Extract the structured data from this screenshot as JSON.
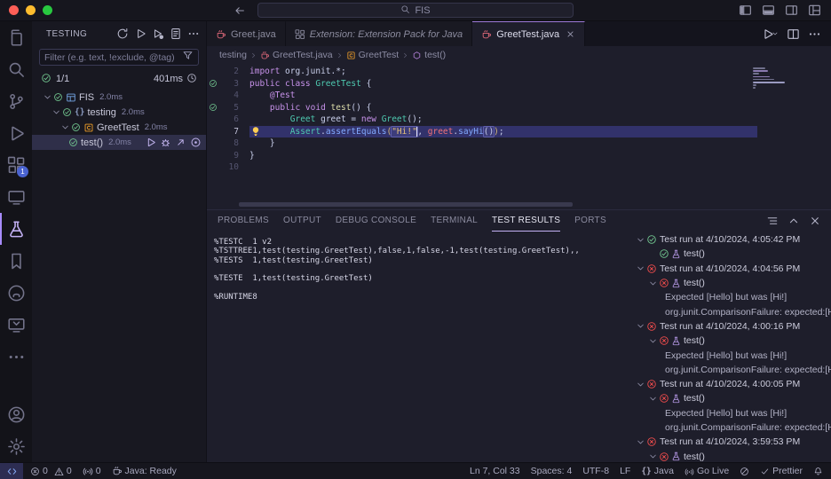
{
  "colors": {
    "accent_purple": "#a78bfa",
    "pass_green": "#73c991",
    "fail_red": "#f14c4c",
    "badge_blue": "#4a63d0",
    "java_red": "#e0697a",
    "class_orange": "#ee9d28",
    "method_purple": "#b180d7",
    "keyword_purple": "#c792ea",
    "type_teal": "#4ec9b0",
    "call_blue": "#82aaff",
    "string_amber": "#e5c07b"
  },
  "titlebar": {
    "search_value": "FIS",
    "window_controls": [
      "toggle-primary-sidebar",
      "toggle-panel",
      "toggle-secondary-sidebar",
      "customize-layout"
    ]
  },
  "activity_bar": {
    "extensions_badge": "1",
    "items": [
      {
        "name": "explorer",
        "icon": "files"
      },
      {
        "name": "search",
        "icon": "search"
      },
      {
        "name": "source-control",
        "icon": "scm"
      },
      {
        "name": "run-and-debug",
        "icon": "debug"
      },
      {
        "name": "extensions",
        "icon": "ext",
        "badge": "1"
      },
      {
        "name": "remote-window",
        "icon": "monitor"
      },
      {
        "name": "testing",
        "icon": "beaker",
        "active": true
      },
      {
        "name": "bookmarks",
        "icon": "bookmark"
      },
      {
        "name": "github",
        "icon": "github"
      },
      {
        "name": "remote-explorer",
        "icon": "monitor2"
      },
      {
        "name": "additional-views",
        "icon": "ellipsis"
      }
    ],
    "bottom_items": [
      {
        "name": "accounts",
        "icon": "account"
      },
      {
        "name": "manage",
        "icon": "gear"
      }
    ]
  },
  "sidebar": {
    "title": "TESTING",
    "actions": [
      {
        "name": "refresh-tests",
        "icon": "refresh"
      },
      {
        "name": "run-all-tests",
        "icon": "play"
      },
      {
        "name": "debug-all-tests",
        "icon": "playdot"
      },
      {
        "name": "show-test-output",
        "icon": "doc"
      },
      {
        "name": "more-view-actions",
        "icon": "ellipsis"
      }
    ],
    "filter_placeholder": "Filter (e.g. text, !exclude, @tag)",
    "summary": {
      "passed": "1/1",
      "duration": "401ms"
    },
    "tree": [
      {
        "label": "FIS",
        "duration": "2.0ms",
        "indent": 0,
        "icon": "grid",
        "icon_color": "#75a7e8",
        "twisty": true,
        "status": "pass"
      },
      {
        "label": "testing",
        "duration": "2.0ms",
        "indent": 1,
        "icon": "braces",
        "icon_color": "#8a9ac0",
        "twisty": true,
        "status": "pass"
      },
      {
        "label": "GreetTest",
        "duration": "2.0ms",
        "indent": 2,
        "icon": "classicon",
        "icon_color": "#ee9d28",
        "twisty": true,
        "status": "pass"
      },
      {
        "label": "test()",
        "duration": "2.0ms",
        "indent": 3,
        "twisty": false,
        "status": "pass",
        "selected": true,
        "actions": [
          {
            "name": "run-test",
            "icon": "play"
          },
          {
            "name": "debug-test",
            "icon": "bug"
          },
          {
            "name": "go-to-test",
            "icon": "goto"
          },
          {
            "name": "pick-test",
            "icon": "target"
          }
        ]
      }
    ]
  },
  "editor": {
    "tabs": [
      {
        "label": "Greet.java",
        "icon": "coffee",
        "icon_color": "#e0697a",
        "active": false,
        "italic": false,
        "close": false
      },
      {
        "label": "Extension: Extension Pack for Java",
        "icon": "ext",
        "icon_color": "#8a8a9e",
        "active": false,
        "italic": true,
        "close": false
      },
      {
        "label": "GreetTest.java",
        "icon": "coffee",
        "icon_color": "#e0697a",
        "active": true,
        "italic": false,
        "close": true
      }
    ],
    "actions": [
      {
        "name": "run-java",
        "icon": "play",
        "dropdown": true
      },
      {
        "name": "split-editor",
        "icon": "split"
      },
      {
        "name": "more-editor-actions",
        "icon": "ellipsis"
      }
    ],
    "breadcrumbs": [
      {
        "label": "testing"
      },
      {
        "label": "GreetTest.java",
        "icon": "coffee",
        "icon_color": "#e0697a"
      },
      {
        "label": "GreetTest",
        "icon": "classicon",
        "icon_color": "#ee9d28"
      },
      {
        "label": "test()",
        "icon": "method",
        "icon_color": "#b180d7"
      }
    ],
    "code": {
      "lines": [
        {
          "num": "2",
          "tokens": [
            {
              "c": "k",
              "t": "import"
            },
            {
              "c": "d",
              "t": " org.junit.*;"
            }
          ]
        },
        {
          "num": "3",
          "gutter": "pass",
          "tokens": [
            {
              "c": "k",
              "t": "public class "
            },
            {
              "c": "t",
              "t": "GreetTest"
            },
            {
              "c": "d",
              "t": " {"
            }
          ]
        },
        {
          "num": "4",
          "tokens": [
            {
              "c": "d",
              "t": "    "
            },
            {
              "c": "a",
              "t": "@Test"
            }
          ]
        },
        {
          "num": "5",
          "gutter": "pass",
          "tokens": [
            {
              "c": "d",
              "t": "    "
            },
            {
              "c": "k",
              "t": "public void "
            },
            {
              "c": "md",
              "t": "test"
            },
            {
              "c": "d",
              "t": "() {"
            }
          ]
        },
        {
          "num": "6",
          "tokens": [
            {
              "c": "d",
              "t": "        "
            },
            {
              "c": "t",
              "t": "Greet"
            },
            {
              "c": "d",
              "t": " greet = "
            },
            {
              "c": "k",
              "t": "new"
            },
            {
              "c": "d",
              "t": " "
            },
            {
              "c": "t",
              "t": "Greet"
            },
            {
              "c": "d",
              "t": "();"
            }
          ]
        },
        {
          "num": "7",
          "current": true,
          "lightbulb": true,
          "tokens": [
            {
              "c": "d",
              "t": "        "
            },
            {
              "c": "t",
              "t": "Assert"
            },
            {
              "c": "d",
              "t": "."
            },
            {
              "c": "mc",
              "t": "assertEquals"
            },
            {
              "c": "pb",
              "t": "("
            },
            {
              "c": "s",
              "t": "\"Hi!\"",
              "boxed": true,
              "cursor_after": true
            },
            {
              "c": "d",
              "t": ", "
            },
            {
              "c": "r",
              "t": "greet"
            },
            {
              "c": "d",
              "t": "."
            },
            {
              "c": "mc",
              "t": "sayHi"
            },
            {
              "c": "d",
              "t": "()",
              "boxed": true
            },
            {
              "c": "pb",
              "t": ")"
            },
            {
              "c": "d",
              "t": ";"
            }
          ]
        },
        {
          "num": "8",
          "tokens": [
            {
              "c": "d",
              "t": "    }"
            }
          ]
        },
        {
          "num": "9",
          "tokens": [
            {
              "c": "d",
              "t": "}"
            }
          ]
        },
        {
          "num": "10",
          "tokens": []
        }
      ]
    }
  },
  "panel": {
    "tabs": [
      {
        "label": "PROBLEMS"
      },
      {
        "label": "OUTPUT"
      },
      {
        "label": "DEBUG CONSOLE"
      },
      {
        "label": "TERMINAL"
      },
      {
        "label": "TEST RESULTS",
        "active": true
      },
      {
        "label": "PORTS"
      }
    ],
    "actions": [
      {
        "name": "view-options",
        "icon": "listtree"
      },
      {
        "name": "maximize-panel",
        "icon": "chevup"
      },
      {
        "name": "close-panel",
        "icon": "close"
      }
    ],
    "output_lines": [
      "%TESTC  1 v2",
      "%TSTTREE1,test(testing.GreetTest),false,1,false,-1,test(testing.GreetTest),,",
      "%TESTS  1,test(testing.GreetTest)",
      "",
      "%TESTE  1,test(testing.GreetTest)",
      "",
      "%RUNTIME8"
    ],
    "runs": [
      {
        "kind": "run",
        "status": "pass",
        "label": "Test run at 4/10/2024, 4:05:42 PM",
        "chevron": true
      },
      {
        "kind": "test",
        "status": "pass",
        "label": "test()",
        "chevron": false
      },
      {
        "kind": "run",
        "status": "fail",
        "label": "Test run at 4/10/2024, 4:04:56 PM",
        "chevron": true
      },
      {
        "kind": "test",
        "status": "fail",
        "label": "test()",
        "chevron": true
      },
      {
        "kind": "detail",
        "label": "Expected [Hello] but was [Hi!]"
      },
      {
        "kind": "detail",
        "label": "org.junit.ComparisonFailure: expected:[H[..."
      },
      {
        "kind": "run",
        "status": "fail",
        "label": "Test run at 4/10/2024, 4:00:16 PM",
        "chevron": true
      },
      {
        "kind": "test",
        "status": "fail",
        "label": "test()",
        "chevron": true
      },
      {
        "kind": "detail",
        "label": "Expected [Hello] but was [Hi!]"
      },
      {
        "kind": "detail",
        "label": "org.junit.ComparisonFailure: expected:[H[..."
      },
      {
        "kind": "run",
        "status": "fail",
        "label": "Test run at 4/10/2024, 4:00:05 PM",
        "chevron": true
      },
      {
        "kind": "test",
        "status": "fail",
        "label": "test()",
        "chevron": true
      },
      {
        "kind": "detail",
        "label": "Expected [Hello] but was [Hi!]"
      },
      {
        "kind": "detail",
        "label": "org.junit.ComparisonFailure: expected:[H[..."
      },
      {
        "kind": "run",
        "status": "fail",
        "label": "Test run at 4/10/2024, 3:59:53 PM",
        "chevron": true
      },
      {
        "kind": "test",
        "status": "fail",
        "label": "test()",
        "chevron": true
      }
    ]
  },
  "statusbar": {
    "left": [
      {
        "name": "remote-indicator",
        "icon": "remote",
        "text": ""
      },
      {
        "name": "problems-status",
        "error_count": "0",
        "warning_count": "0"
      },
      {
        "name": "port-forward",
        "icon": "broadcast",
        "text": "0"
      },
      {
        "name": "java-status",
        "icon": "coffee",
        "text": "Java: Ready"
      }
    ],
    "right": [
      {
        "name": "cursor-position",
        "text": "Ln 7, Col 33"
      },
      {
        "name": "indentation",
        "text": "Spaces: 4"
      },
      {
        "name": "encoding",
        "text": "UTF-8"
      },
      {
        "name": "eol-sequence",
        "text": "LF"
      },
      {
        "name": "language-mode",
        "icon": "braces",
        "text": "Java"
      },
      {
        "name": "go-live",
        "icon": "broadcast",
        "text": "Go Live"
      },
      {
        "name": "exclude-indicator",
        "icon": "slash",
        "text": ""
      },
      {
        "name": "prettier",
        "icon": "check",
        "text": "Prettier"
      },
      {
        "name": "notifications",
        "icon": "bell",
        "text": ""
      }
    ]
  }
}
